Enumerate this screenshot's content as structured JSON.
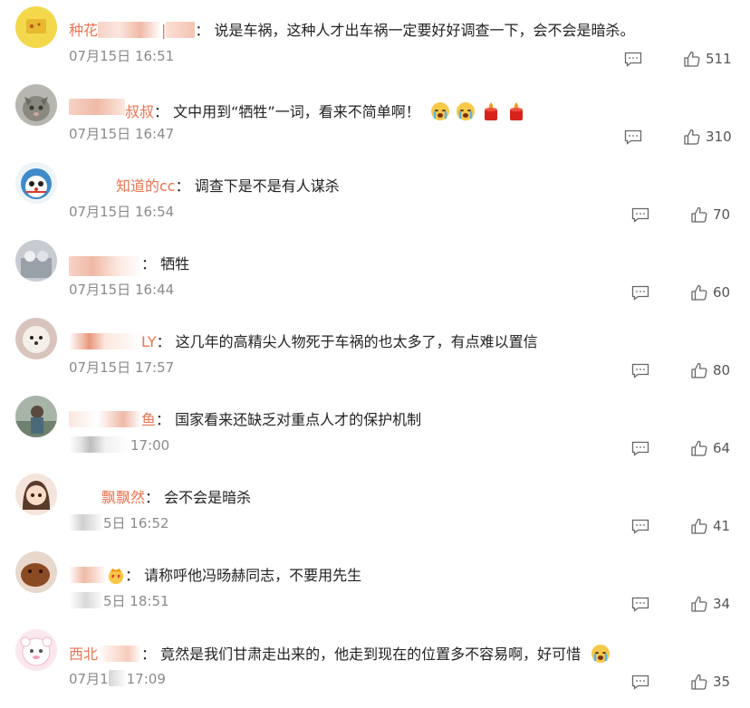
{
  "comments": [
    {
      "name_prefix": "种花",
      "name_suffix": "",
      "text": "说是车祸，这种人才出车祸一定要好好调查一下，会不会是暗杀。",
      "time": "07月15日 16:51",
      "likes": "511",
      "emoji": []
    },
    {
      "name_prefix": "",
      "name_suffix": "叔叔",
      "text": "文中用到“牺牲”一词，看来不简单啊！",
      "time": "07月15日 16:47",
      "likes": "310",
      "emoji": [
        "crying-face-icon",
        "crying-face-icon",
        "candle-icon",
        "candle-icon"
      ]
    },
    {
      "name_prefix": "",
      "name_suffix": "知道的cc",
      "text": "调查下是不是有人谋杀",
      "time": "07月15日 16:54",
      "likes": "70",
      "emoji": []
    },
    {
      "name_prefix": "",
      "name_suffix": "",
      "text": "牺牲",
      "time": "07月15日 16:44",
      "likes": "60",
      "emoji": []
    },
    {
      "name_prefix": "",
      "name_suffix": "LY",
      "text": "这几年的高精尖人物死于车祸的也太多了，有点难以置信",
      "time": "07月15日 17:57",
      "likes": "80",
      "emoji": []
    },
    {
      "name_prefix": "",
      "name_suffix": "鱼",
      "text": "国家看来还缺乏对重点人才的保护机制",
      "time": "17:00",
      "likes": "64",
      "emoji": []
    },
    {
      "name_prefix": "",
      "name_suffix": "飘飘然",
      "text": "会不会是暗杀",
      "time": "5日 16:52",
      "likes": "41",
      "emoji": []
    },
    {
      "name_prefix": "",
      "name_suffix": "",
      "text": "请称呼他冯旸赫同志，不要用先生",
      "time": "5日 18:51",
      "likes": "34",
      "emoji": []
    },
    {
      "name_prefix": "西北",
      "name_suffix": "",
      "text": "竟然是我们甘肃走出来的，他走到现在的位置多不容易啊，好可惜",
      "time": "07月1",
      "time2": "17:09",
      "likes": "35",
      "emoji": [
        "crying-face-icon"
      ]
    }
  ],
  "colors": {
    "username": "#eb7350",
    "time": "#8a8a8a",
    "text": "#222222"
  }
}
